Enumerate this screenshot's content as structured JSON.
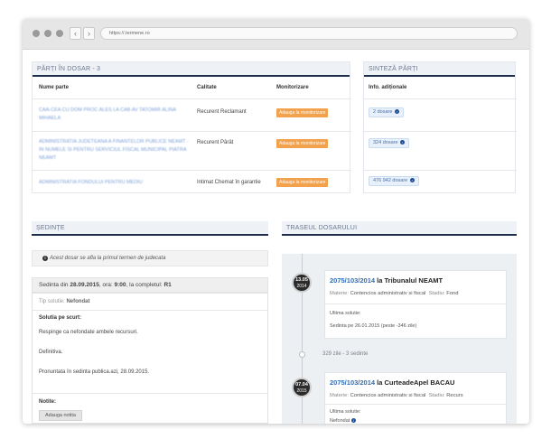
{
  "browser": {
    "url": "https://.termene.ro",
    "back_glyph": "‹",
    "forward_glyph": "›"
  },
  "parti": {
    "title": "PĂRȚI ÎN DOSAR - 3",
    "headers": {
      "nume": "Nume parte",
      "calitate": "Calitate",
      "monitorizare": "Monitorizare"
    },
    "rows": [
      {
        "nume": "CAA-CEA CU DOM PROC ALES LA CAB AV TATOMIR ALINA MIHAELA",
        "calitate": "Recurent Reclamant",
        "button": "Adauga la monitorizare"
      },
      {
        "nume": "ADMINISTRATIA JUDETEANA A FINANTELOR PUBLICE NEAMT - IN NUMELE SI PENTRU SERVICIUL FISCAL MUNICIPAL PIATRA NEAMT",
        "calitate": "Recurent Pârât",
        "button": "Adauga la monitorizare"
      },
      {
        "nume": "ADMINISTRATIA FONDULUI PENTRU MEDIU",
        "calitate": "Intimat Chemat în garantie",
        "button": "Adauga la monitorizare"
      }
    ]
  },
  "sinteza": {
    "title": "SINTEZĂ PĂRȚI",
    "header": "Info. adiționale",
    "items": [
      "2 dosare",
      "324 dosare",
      "476 942 dosare"
    ],
    "icon_glyph": "›"
  },
  "sedinte": {
    "title": "ȘEDINȚE",
    "notice_icon": "i",
    "notice": "Acest dosar se afla la primul termen de judecata",
    "head_prefix": "Sedinta din ",
    "date": "28.09.2015",
    "ora_label": ", ora: ",
    "ora": "9:00",
    "complet_label": ", la completul: ",
    "complet": "R1",
    "tip_label": "Tip solutie: ",
    "tip": "Nefondat",
    "solutia_label": "Solutia pe scurt:",
    "lines": [
      "Respinge ca nefondate ambele recursuri.",
      "Definitiva.",
      "Pronuntata în sedinta publica.azi, 28.09.2015."
    ],
    "note_label": "Notite:",
    "note_button": "Adauga notita"
  },
  "traseu": {
    "title": "TRASEUL DOSARULUI",
    "events": [
      {
        "day": "13.05",
        "year": "2014",
        "dosar": "2075/103/2014",
        "instanta": "la Tribunalul NEAMT",
        "materie_label": "Materie: ",
        "materie": "Contencios administrativ si fiscal",
        "stadiu_label": "Stadiu: ",
        "stadiu": "Fond",
        "solutie_label": "Ultima solutie:",
        "solutie": "Sedinta pe 26.01.2015 (peste -346 zile)"
      },
      {
        "day": "07.04",
        "year": "2015",
        "dosar": "2075/103/2014",
        "instanta": "la CurteadeApel BACAU",
        "materie_label": "Materie: ",
        "materie": "Contencios administrativ si fiscal",
        "stadiu_label": "Stadiu: ",
        "stadiu": "Recurs",
        "solutie_label": "Ultima solutie:",
        "solutie": "Nefondat",
        "info_icon": "i"
      }
    ],
    "gap": "329 zile - 3 sedinte"
  }
}
